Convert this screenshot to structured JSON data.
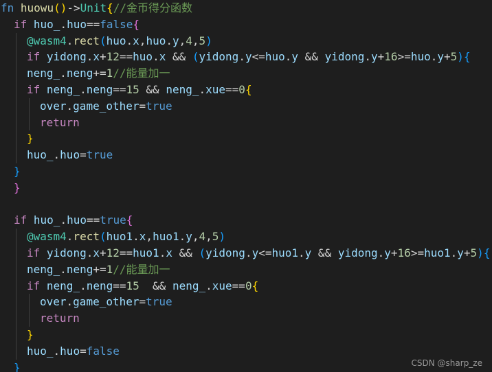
{
  "theme": {
    "background": "#1e1e1e",
    "colors": {
      "keyword": "#569cd6",
      "control": "#c586c0",
      "variable": "#9cdcfe",
      "function": "#dcdcaa",
      "type": "#4ec9b0",
      "number": "#b5cea8",
      "comment": "#6a9955",
      "text": "#d4d4d4",
      "bracket1": "#ffd700",
      "bracket2": "#da70d6",
      "bracket3": "#179fff"
    }
  },
  "code": {
    "lines": [
      {
        "indent": 0,
        "tokens": [
          [
            "fn",
            "keyword"
          ],
          [
            " ",
            "text"
          ],
          [
            "huowu",
            "function"
          ],
          [
            "()",
            "bracket1"
          ],
          [
            "->",
            "text"
          ],
          [
            "Unit",
            "type"
          ],
          [
            "{",
            "bracket1"
          ],
          [
            "//金币得分函数",
            "comment"
          ]
        ]
      },
      {
        "indent": 1,
        "tokens": [
          [
            "if",
            "control"
          ],
          [
            " ",
            "text"
          ],
          [
            "huo_",
            "variable"
          ],
          [
            ".",
            "text"
          ],
          [
            "huo",
            "variable"
          ],
          [
            "==",
            "text"
          ],
          [
            "false",
            "keyword"
          ],
          [
            "{",
            "bracket2"
          ]
        ]
      },
      {
        "indent": 2,
        "tokens": [
          [
            "@wasm4",
            "type"
          ],
          [
            ".",
            "text"
          ],
          [
            "rect",
            "function"
          ],
          [
            "(",
            "bracket3"
          ],
          [
            "huo",
            "variable"
          ],
          [
            ".",
            "text"
          ],
          [
            "x",
            "variable"
          ],
          [
            ",",
            "text"
          ],
          [
            "huo",
            "variable"
          ],
          [
            ".",
            "text"
          ],
          [
            "y",
            "variable"
          ],
          [
            ",",
            "text"
          ],
          [
            "4",
            "number"
          ],
          [
            ",",
            "text"
          ],
          [
            "5",
            "number"
          ],
          [
            ")",
            "bracket3"
          ]
        ]
      },
      {
        "indent": 2,
        "tokens": [
          [
            "if",
            "control"
          ],
          [
            " ",
            "text"
          ],
          [
            "yidong",
            "variable"
          ],
          [
            ".",
            "text"
          ],
          [
            "x",
            "variable"
          ],
          [
            "+",
            "text"
          ],
          [
            "12",
            "number"
          ],
          [
            "==",
            "text"
          ],
          [
            "huo",
            "variable"
          ],
          [
            ".",
            "text"
          ],
          [
            "x",
            "variable"
          ],
          [
            " && ",
            "text"
          ],
          [
            "(",
            "bracket3"
          ],
          [
            "yidong",
            "variable"
          ],
          [
            ".",
            "text"
          ],
          [
            "y",
            "variable"
          ],
          [
            "<=",
            "text"
          ],
          [
            "huo",
            "variable"
          ],
          [
            ".",
            "text"
          ],
          [
            "y",
            "variable"
          ],
          [
            " && ",
            "text"
          ],
          [
            "yidong",
            "variable"
          ],
          [
            ".",
            "text"
          ],
          [
            "y",
            "variable"
          ],
          [
            "+",
            "text"
          ],
          [
            "16",
            "number"
          ],
          [
            ">=",
            "text"
          ],
          [
            "huo",
            "variable"
          ],
          [
            ".",
            "text"
          ],
          [
            "y",
            "variable"
          ],
          [
            "+",
            "text"
          ],
          [
            "5",
            "number"
          ],
          [
            ")",
            "bracket3"
          ],
          [
            "{",
            "bracket3"
          ]
        ]
      },
      {
        "indent": 2,
        "tokens": [
          [
            "neng_",
            "variable"
          ],
          [
            ".",
            "text"
          ],
          [
            "neng",
            "variable"
          ],
          [
            "+=",
            "text"
          ],
          [
            "1",
            "number"
          ],
          [
            "//能量加一",
            "comment"
          ]
        ]
      },
      {
        "indent": 2,
        "tokens": [
          [
            "if",
            "control"
          ],
          [
            " ",
            "text"
          ],
          [
            "neng_",
            "variable"
          ],
          [
            ".",
            "text"
          ],
          [
            "neng",
            "variable"
          ],
          [
            "==",
            "text"
          ],
          [
            "15",
            "number"
          ],
          [
            " && ",
            "text"
          ],
          [
            "neng_",
            "variable"
          ],
          [
            ".",
            "text"
          ],
          [
            "xue",
            "variable"
          ],
          [
            "==",
            "text"
          ],
          [
            "0",
            "number"
          ],
          [
            "{",
            "bracket1"
          ]
        ]
      },
      {
        "indent": 3,
        "tokens": [
          [
            "over",
            "variable"
          ],
          [
            ".",
            "text"
          ],
          [
            "game_other",
            "variable"
          ],
          [
            "=",
            "text"
          ],
          [
            "true",
            "keyword"
          ]
        ]
      },
      {
        "indent": 3,
        "tokens": [
          [
            "return",
            "control"
          ]
        ]
      },
      {
        "indent": 2,
        "tokens": [
          [
            "}",
            "bracket1"
          ]
        ]
      },
      {
        "indent": 2,
        "tokens": [
          [
            "huo_",
            "variable"
          ],
          [
            ".",
            "text"
          ],
          [
            "huo",
            "variable"
          ],
          [
            "=",
            "text"
          ],
          [
            "true",
            "keyword"
          ]
        ]
      },
      {
        "indent": 1,
        "tokens": [
          [
            "}",
            "bracket3"
          ]
        ]
      },
      {
        "indent": 1,
        "tokens": [
          [
            "}",
            "bracket2"
          ]
        ]
      },
      {
        "indent": 0,
        "tokens": []
      },
      {
        "indent": 1,
        "tokens": [
          [
            "if",
            "control"
          ],
          [
            " ",
            "text"
          ],
          [
            "huo_",
            "variable"
          ],
          [
            ".",
            "text"
          ],
          [
            "huo",
            "variable"
          ],
          [
            "==",
            "text"
          ],
          [
            "true",
            "keyword"
          ],
          [
            "{",
            "bracket2"
          ]
        ]
      },
      {
        "indent": 2,
        "tokens": [
          [
            "@wasm4",
            "type"
          ],
          [
            ".",
            "text"
          ],
          [
            "rect",
            "function"
          ],
          [
            "(",
            "bracket3"
          ],
          [
            "huo1",
            "variable"
          ],
          [
            ".",
            "text"
          ],
          [
            "x",
            "variable"
          ],
          [
            ",",
            "text"
          ],
          [
            "huo1",
            "variable"
          ],
          [
            ".",
            "text"
          ],
          [
            "y",
            "variable"
          ],
          [
            ",",
            "text"
          ],
          [
            "4",
            "number"
          ],
          [
            ",",
            "text"
          ],
          [
            "5",
            "number"
          ],
          [
            ")",
            "bracket3"
          ]
        ]
      },
      {
        "indent": 2,
        "tokens": [
          [
            "if",
            "control"
          ],
          [
            " ",
            "text"
          ],
          [
            "yidong",
            "variable"
          ],
          [
            ".",
            "text"
          ],
          [
            "x",
            "variable"
          ],
          [
            "+",
            "text"
          ],
          [
            "12",
            "number"
          ],
          [
            "==",
            "text"
          ],
          [
            "huo1",
            "variable"
          ],
          [
            ".",
            "text"
          ],
          [
            "x",
            "variable"
          ],
          [
            " && ",
            "text"
          ],
          [
            "(",
            "bracket3"
          ],
          [
            "yidong",
            "variable"
          ],
          [
            ".",
            "text"
          ],
          [
            "y",
            "variable"
          ],
          [
            "<=",
            "text"
          ],
          [
            "huo1",
            "variable"
          ],
          [
            ".",
            "text"
          ],
          [
            "y",
            "variable"
          ],
          [
            " && ",
            "text"
          ],
          [
            "yidong",
            "variable"
          ],
          [
            ".",
            "text"
          ],
          [
            "y",
            "variable"
          ],
          [
            "+",
            "text"
          ],
          [
            "16",
            "number"
          ],
          [
            ">=",
            "text"
          ],
          [
            "huo1",
            "variable"
          ],
          [
            ".",
            "text"
          ],
          [
            "y",
            "variable"
          ],
          [
            "+",
            "text"
          ],
          [
            "5",
            "number"
          ],
          [
            ")",
            "bracket3"
          ],
          [
            "{",
            "bracket3"
          ]
        ]
      },
      {
        "indent": 2,
        "tokens": [
          [
            "neng_",
            "variable"
          ],
          [
            ".",
            "text"
          ],
          [
            "neng",
            "variable"
          ],
          [
            "+=",
            "text"
          ],
          [
            "1",
            "number"
          ],
          [
            "//能量加一",
            "comment"
          ]
        ]
      },
      {
        "indent": 2,
        "tokens": [
          [
            "if",
            "control"
          ],
          [
            " ",
            "text"
          ],
          [
            "neng_",
            "variable"
          ],
          [
            ".",
            "text"
          ],
          [
            "neng",
            "variable"
          ],
          [
            "==",
            "text"
          ],
          [
            "15",
            "number"
          ],
          [
            "  && ",
            "text"
          ],
          [
            "neng_",
            "variable"
          ],
          [
            ".",
            "text"
          ],
          [
            "xue",
            "variable"
          ],
          [
            "==",
            "text"
          ],
          [
            "0",
            "number"
          ],
          [
            "{",
            "bracket1"
          ]
        ]
      },
      {
        "indent": 3,
        "tokens": [
          [
            "over",
            "variable"
          ],
          [
            ".",
            "text"
          ],
          [
            "game_other",
            "variable"
          ],
          [
            "=",
            "text"
          ],
          [
            "true",
            "keyword"
          ]
        ]
      },
      {
        "indent": 3,
        "tokens": [
          [
            "return",
            "control"
          ]
        ]
      },
      {
        "indent": 2,
        "tokens": [
          [
            "}",
            "bracket1"
          ]
        ]
      },
      {
        "indent": 2,
        "tokens": [
          [
            "huo_",
            "variable"
          ],
          [
            ".",
            "text"
          ],
          [
            "huo",
            "variable"
          ],
          [
            "=",
            "text"
          ],
          [
            "false",
            "keyword"
          ]
        ]
      },
      {
        "indent": 1,
        "tokens": [
          [
            "}",
            "bracket3"
          ]
        ]
      }
    ]
  },
  "watermark": {
    "text": "CSDN @sharp_ze"
  }
}
